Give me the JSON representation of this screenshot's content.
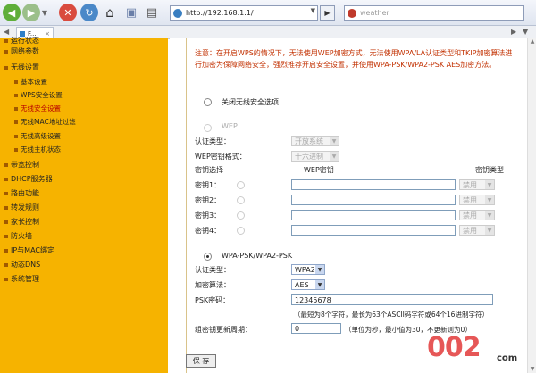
{
  "browser": {
    "url": "http://192.168.1.1/",
    "search_placeholder": "weather",
    "tab_label": "F..."
  },
  "sidebar": {
    "items": [
      {
        "label": "运行状态",
        "sub": false
      },
      {
        "label": "网络参数",
        "sub": false
      },
      {
        "label": "无线设置",
        "sub": false
      },
      {
        "label": "基本设置",
        "sub": true
      },
      {
        "label": "WPS安全设置",
        "sub": true
      },
      {
        "label": "无线安全设置",
        "sub": true,
        "active": true
      },
      {
        "label": "无线MAC地址过滤",
        "sub": true
      },
      {
        "label": "无线高级设置",
        "sub": true
      },
      {
        "label": "无线主机状态",
        "sub": true
      },
      {
        "label": "带宽控制",
        "sub": false
      },
      {
        "label": "DHCP服务器",
        "sub": false
      },
      {
        "label": "路由功能",
        "sub": false
      },
      {
        "label": "转发规则",
        "sub": false
      },
      {
        "label": "家长控制",
        "sub": false
      },
      {
        "label": "防火墙",
        "sub": false
      },
      {
        "label": "IP与MAC绑定",
        "sub": false
      },
      {
        "label": "动态DNS",
        "sub": false
      },
      {
        "label": "系统管理",
        "sub": false
      }
    ]
  },
  "main": {
    "notice": "注意：在开启WPS的情况下，无法使用WEP加密方式，无法使用WPA/LA认证类型和TKIP加密算法进行加密为保障网络安全，强烈推荐开启安全设置，并使用WPA-PSK/WPA2-PSK AES加密方法。",
    "off_option": "关闭无线安全选项",
    "wep": {
      "title": "WEP",
      "auth_label": "认证类型：",
      "auth_value": "开放系统",
      "format_label": "WEP密钥格式：",
      "format_value": "十六进制",
      "col_select": "密钥选择",
      "col_key": "WEP密钥",
      "col_type": "密钥类型",
      "keys": [
        {
          "label": "密钥1：",
          "type": "禁用"
        },
        {
          "label": "密钥2：",
          "type": "禁用"
        },
        {
          "label": "密钥3：",
          "type": "禁用"
        },
        {
          "label": "密钥4：",
          "type": "禁用"
        }
      ]
    },
    "wpa": {
      "title": "WPA-PSK/WPA2-PSK",
      "auth_label": "认证类型：",
      "auth_value": "WPA2",
      "algo_label": "加密算法：",
      "algo_value": "AES",
      "psk_label": "PSK密码：",
      "psk_value": "12345678",
      "psk_hint": "（最短为8个字符，最长为63个ASCII码字符或64个16进制字符）",
      "period_label": "组密钥更新周期：",
      "period_value": "0",
      "period_hint": "（单位为秒，最小值为30，不更新则为0）"
    },
    "save_label": "保 存"
  },
  "watermark": {
    "text": "002",
    "suffix": "com"
  }
}
